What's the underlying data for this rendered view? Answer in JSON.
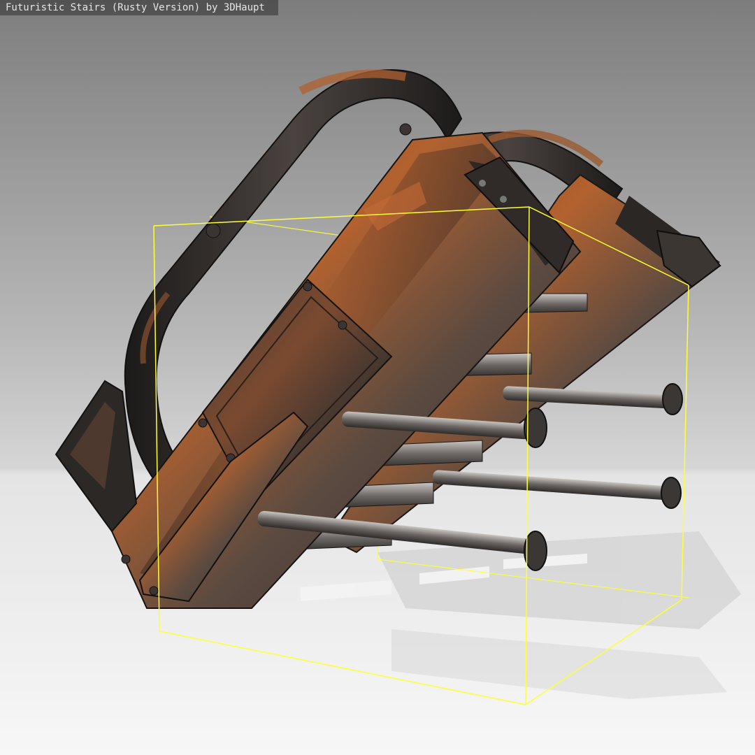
{
  "viewer": {
    "caption": "Futuristic Stairs (Rusty Version) by 3DHaupt"
  },
  "scene": {
    "object": "futuristic-rusty-stairs",
    "bounding_box_color": "#ffff33",
    "rust_color": "#b25a2c",
    "metal_dark": "#2a2624",
    "steel_color": "#8a8682",
    "background_top": "#8c8c8c",
    "floor_color": "#f2f2f2"
  }
}
